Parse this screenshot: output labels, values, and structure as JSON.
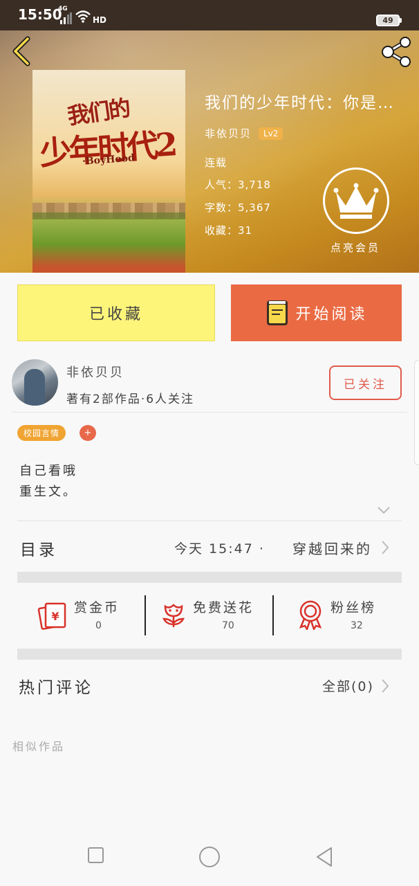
{
  "status_bar": {
    "time": "15:50",
    "network": "4G",
    "hd": "HD",
    "battery": "49"
  },
  "header": {
    "back_icon": "back-chevron-icon",
    "share_icon": "share-icon"
  },
  "book": {
    "cover_title_line1": "我们的",
    "cover_title_line2": "少年时代2",
    "cover_subtitle": "·BoyHood",
    "title": "我们的少年时代：你是…",
    "author": "非依贝贝",
    "level": "Lv2",
    "status": "连载",
    "popularity": "人气：3,718",
    "word_count": "字数：5,367",
    "favorites": "收藏：31",
    "vip_label": "点亮会员"
  },
  "actions": {
    "collected": "已收藏",
    "start_reading": "开始阅读"
  },
  "author_card": {
    "name": "非依贝贝",
    "stats": "著有2部作品·6人关注",
    "follow": "已关注"
  },
  "tags": [
    {
      "label": "校园言情"
    }
  ],
  "tag_add": "+",
  "description": [
    "自己看哦",
    "重生文。"
  ],
  "toc": {
    "label": "目录",
    "updated": "今天 15:47 ·",
    "latest_chapter": "穿越回来的"
  },
  "stats": [
    {
      "label": "赏金币",
      "value": "0",
      "icon": "red-envelope-icon"
    },
    {
      "label": "免费送花",
      "value": "70",
      "icon": "flower-icon"
    },
    {
      "label": "粉丝榜",
      "value": "32",
      "icon": "award-medal-icon"
    }
  ],
  "comments": {
    "label": "热门评论",
    "all": "全部(0)"
  },
  "similar": "相似作品",
  "colors": {
    "accent_orange": "#ea6a43",
    "collected_yellow": "#fdf57a",
    "follow_red": "#e05a4a",
    "tag_orange": "#f0a432"
  }
}
